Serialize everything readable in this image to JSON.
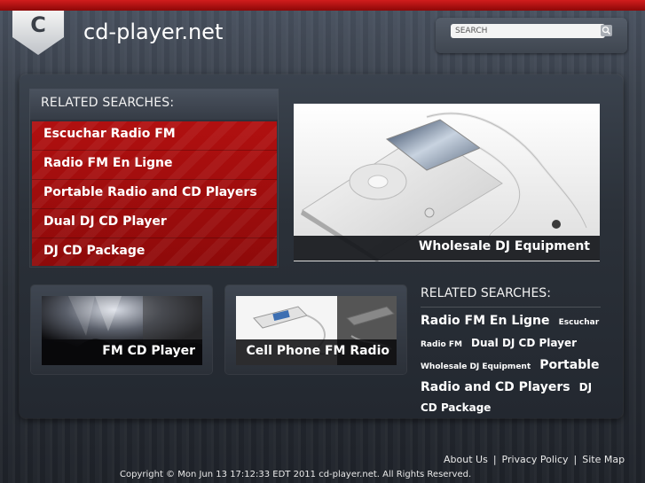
{
  "site": {
    "logo_letter": "C",
    "title": "cd-player.net"
  },
  "search": {
    "placeholder": "SEARCH",
    "button_icon": "search-icon"
  },
  "related_box": {
    "heading": "RELATED SEARCHES:",
    "items": [
      {
        "label": "Escuchar Radio FM"
      },
      {
        "label": "Radio FM En Ligne"
      },
      {
        "label": "Portable Radio and CD Players"
      },
      {
        "label": "Dual DJ CD Player"
      },
      {
        "label": "DJ CD Package"
      }
    ]
  },
  "hero": {
    "caption": "Wholesale DJ Equipment"
  },
  "thumbs": [
    {
      "caption": "FM CD Player"
    },
    {
      "caption": "Cell Phone FM Radio"
    }
  ],
  "cloud": {
    "heading": "RELATED SEARCHES:",
    "tags": [
      {
        "label": "Radio FM En Ligne",
        "size": "lg"
      },
      {
        "label": "Escuchar Radio FM",
        "size": "sm"
      },
      {
        "label": "Dual DJ CD Player",
        "size": "md"
      },
      {
        "label": "Wholesale DJ Equipment",
        "size": "sm"
      },
      {
        "label": "Portable Radio and CD Players",
        "size": "lg"
      },
      {
        "label": "DJ CD Package",
        "size": "md"
      }
    ]
  },
  "footer": {
    "links": [
      "About Us",
      "Privacy Policy",
      "Site Map"
    ],
    "separator": "|",
    "copyright": "Copyright © Mon Jun 13 17:12:33 EDT 2011 cd-player.net. All Rights Reserved."
  },
  "colors": {
    "brand_red": "#b11010",
    "background": "#2b3038",
    "text": "#ffffff"
  }
}
